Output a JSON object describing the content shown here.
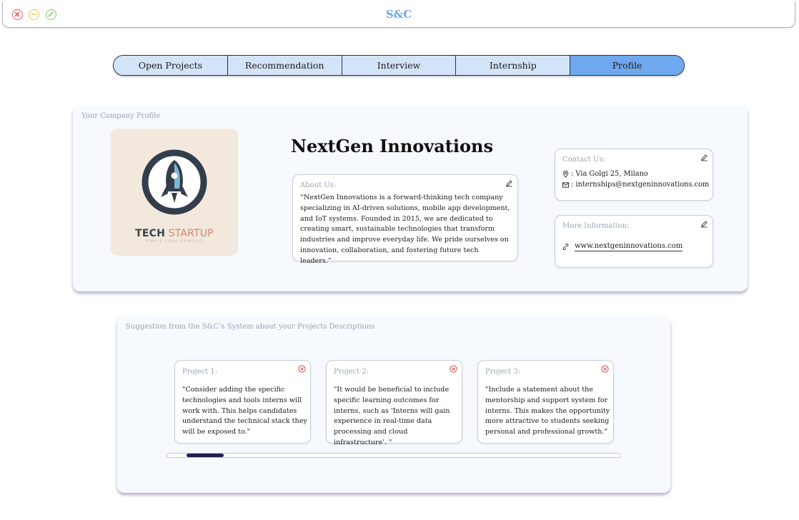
{
  "window": {
    "title": "S&C",
    "controls": [
      {
        "name": "close",
        "icon": "close-circle-icon",
        "color": "#e45a5a"
      },
      {
        "name": "minimize",
        "icon": "minus-circle-icon",
        "color": "#e6c94a"
      },
      {
        "name": "maximize",
        "icon": "slash-circle-icon",
        "color": "#7cc86d"
      }
    ]
  },
  "tabs": [
    {
      "label": "Open Projects",
      "active": false
    },
    {
      "label": "Recommendation",
      "active": false
    },
    {
      "label": "Interview",
      "active": false
    },
    {
      "label": "Internship",
      "active": false
    },
    {
      "label": "Profile",
      "active": true
    }
  ],
  "profile": {
    "section_label": "Your Company Profile",
    "logo": {
      "word1": "TECH",
      "word2": "STARTUP",
      "tagline": "SIMPLE LOGO CONCEPT",
      "icon": "rocket-icon"
    },
    "company_name": "NextGen Innovations",
    "about": {
      "title": "About Us:",
      "text": "“NextGen Innovations is a forward-thinking tech company specializing in AI-driven solutions, mobile app development, and IoT systems. Founded in 2015, we are dedicated to creating smart, sustainable technologies that transform industries and improve everyday life. We pride ourselves on innovation, collaboration, and fostering future tech leaders.”"
    },
    "contact": {
      "title": "Contact Us:",
      "address": ": Via Golgi 25, Milano",
      "email": ": internships@nextgeninnovations.com"
    },
    "more_info": {
      "title": "More Information:",
      "website": "www.nextgeninnovations.com"
    }
  },
  "suggestions": {
    "section_label": "Suggestion from the S&C’s System about your Projects Descriptions",
    "projects": [
      {
        "title": "Project 1:",
        "text": "\"Consider adding the specific technologies and tools interns will work with. This helps candidates understand the technical stack they will be exposed to.\""
      },
      {
        "title": "Project 2:",
        "text": "\"It would be beneficial to include specific learning outcomes for interns, such as 'Interns will gain experience in real-time data processing and cloud infrastructure'. \""
      },
      {
        "title": "Project 3:",
        "text": "\"Include a statement about the mentorship and support system for interns. This makes the opportunity more attractive to students seeking personal and professional growth.\""
      }
    ]
  },
  "colors": {
    "accent": "#6fa8ee",
    "tab_bg": "#d4e4f8",
    "title": "#6aa5ec",
    "scroll_thumb": "#1c2050",
    "remove": "#d14a4a"
  }
}
